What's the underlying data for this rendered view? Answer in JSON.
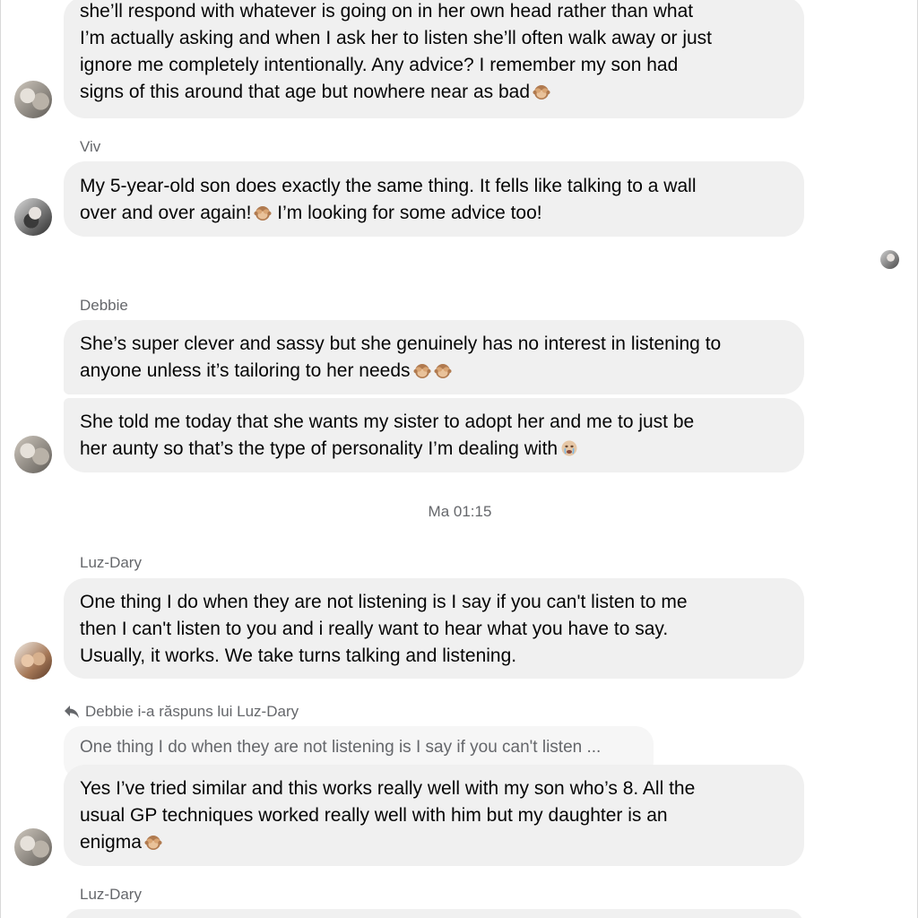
{
  "messages": {
    "debbie_first": {
      "lines": [
        "she’ll respond with whatever is going on in her own head rather than what",
        "I’m actually asking and when I ask her to listen she’ll often walk away or just",
        "ignore me completely intentionally. Any advice? I remember my son had",
        "signs of this around that age but nowhere near as bad"
      ],
      "emoji": "see-no-evil-monkey"
    },
    "viv": {
      "sender": "Viv",
      "lines": [
        "My 5-year-old son does exactly the same thing. It fells like talking to a wall",
        "over and over again!",
        " I’m looking for some advice too!"
      ]
    },
    "debbie_second": {
      "sender": "Debbie",
      "bubble1_lines": [
        "She’s super clever and sassy but she genuinely has no interest in listening to",
        "anyone unless it’s tailoring to her needs"
      ],
      "bubble2_lines": [
        "She told me today that she wants my sister to adopt her and me to just be",
        "her aunty so that’s the type of personality I’m dealing with"
      ]
    },
    "timestamp": "Ma 01:15",
    "luz_first": {
      "sender": "Luz-Dary",
      "lines": [
        "One thing I do when they are not listening is I say if you can't listen to me",
        "then I can't listen to you and i really want to hear what you have to say.",
        "Usually, it works. We take turns talking and listening."
      ]
    },
    "debbie_reply": {
      "reply_label": "Debbie i-a răspuns lui Luz-Dary",
      "quoted": "One thing I do when they are not listening is I say if you can't listen ...",
      "lines": [
        "Yes I’ve tried similar and this works really well with my son who’s 8. All the",
        "usual GP techniques worked really well with him but my daughter is an",
        "enigma"
      ]
    },
    "luz_second": {
      "sender": "Luz-Dary"
    }
  },
  "icons": {
    "reply": "reply-arrow-icon",
    "see_no_evil": "see-no-evil-monkey-icon",
    "crying": "crying-face-icon"
  },
  "colors": {
    "bubble": "#f0f0f0",
    "meta_text": "#65676b",
    "text": "#050505"
  }
}
